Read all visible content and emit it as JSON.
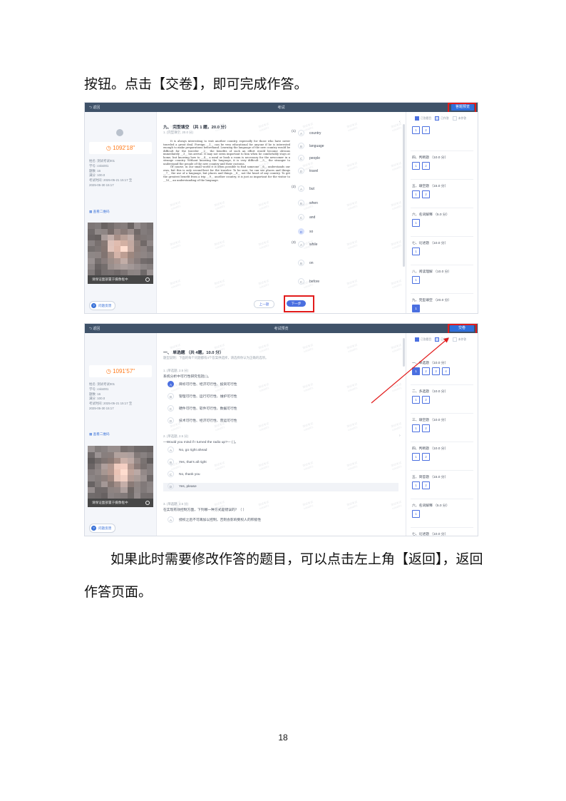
{
  "doc": {
    "top_text": "按钮。点击【交卷】，即可完成作答。",
    "bottom_line1": "如果此时需要修改作答的题目，可以点击左上角【返回】，返回",
    "bottom_line2": "作答页面。",
    "page_number": "18"
  },
  "shot1": {
    "topbar": {
      "back": "返回",
      "title": "考试",
      "button": "答题预览"
    },
    "left": {
      "timer": "1092'18\"",
      "info": "姓名: 测试考试001\n学号: csks001\n题数: 16\n满分: 100.0\n考试时间: 2025-05-21 15:17 至\n2025-05-30 15:17",
      "qr": "查看二维码",
      "cam_caption": "请保证面部置于摄像框中",
      "feedback": "问题反馈"
    },
    "section_title": "九、 完型填空 （共 1 题，20.0 分）",
    "question_meta": "1. (完型填空, 20.0 分)",
    "passage": [
      "It is always interesting to visit another country, especially for those who have never traveled a great deal. Foreign __1__ can be very educational for anyone if he is interested enough to make preparations beforehand. Learning the language of the new country would be difficult for the traveler __2__ the benefits of such an effort would become obvious immediately __3__ his arrival. It may not seem important to him when he comfortably stays at home, but knowing how to __4__ a meal or book a room is necessary for the newcomer in a strange country. Without knowing the language, it is very difficult __5__ the stranger to understand the people of the new country and their customs.",
      "Of course, in our small world it is often possible to find someone __6__ understands our own, but this is only second-best for the traveler. To be sure, he can see places and things __7__ the use of a language, but places and things __8__ not the heart of any country. To get the greatest benefit from a trip __9__ another country, it is just as important for the visitor to __10__ an understanding of the language."
    ],
    "answers": [
      {
        "num": "(1)",
        "options": [
          [
            "A",
            "country"
          ],
          [
            "B",
            "language"
          ],
          [
            "C",
            "people"
          ],
          [
            "D",
            "travel"
          ]
        ],
        "selected": ""
      },
      {
        "num": "(2)",
        "options": [
          [
            "A",
            "but"
          ],
          [
            "B",
            "when"
          ],
          [
            "C",
            "and"
          ],
          [
            "D",
            "so"
          ]
        ],
        "selected": "D"
      },
      {
        "num": "(3)",
        "options": [
          [
            "A",
            "while"
          ],
          [
            "B",
            "on"
          ],
          [
            "C",
            "before"
          ]
        ],
        "selected": ""
      }
    ],
    "nav": {
      "prev": "上一题",
      "next": "下一步"
    },
    "legend": [
      "已答题目",
      "已作答",
      "未作答"
    ],
    "right_sections": [
      {
        "title": "",
        "boxes": [
          "1",
          "2"
        ]
      },
      {
        "title": "四、判断题 （10.0 分）",
        "boxes": [
          "1",
          "2"
        ]
      },
      {
        "title": "五、填空题 （15.0 分）",
        "boxes": [
          "1",
          "2"
        ]
      },
      {
        "title": "六、名词解释 （5.0 分）",
        "boxes": [
          "1"
        ]
      },
      {
        "title": "七、论述题 （10.0 分）",
        "boxes": [
          "1"
        ]
      },
      {
        "title": "八、阅读理解 （10.0 分）",
        "boxes": [
          "1"
        ]
      },
      {
        "title": "九、完型填空 （20.0 分）",
        "boxes": [
          "1"
        ]
      }
    ]
  },
  "shot2": {
    "topbar": {
      "back": "返回",
      "title": "考试预览",
      "button": "交卷"
    },
    "left": {
      "timer": "1091'57\"",
      "info": "姓名: 测试考试001\n学号: csks001\n题数: 16\n满分: 100.0\n考试时间: 2025-05-21 15:17 至\n2025-05-30 15:17",
      "qr": "查看二维码",
      "cam_caption": "请保证面部置于摄像框中",
      "feedback": "问题反馈"
    },
    "section_title": "一、 单选题 （共 4题，10.0 分）",
    "section_note": "题型说明：下面的每个问题都有4个答案供选择，请选择你认为正确的选项。",
    "questions": [
      {
        "meta": "1. (单选题, 2.5 分)",
        "text": "系统分析中可行性研究包括(    )。",
        "options": [
          [
            "A",
            "目标可行性、经济可行性、投资可行性"
          ],
          [
            "B",
            "管理可行性、运行可行性、维护可行性"
          ],
          [
            "C",
            "硬件可行性、软件可行性、数据可行性"
          ],
          [
            "D",
            "技术可行性、经济可行性、营运可行性"
          ]
        ],
        "selected": "A"
      },
      {
        "meta": "2. (单选题, 2.5 分)",
        "text": "—Would you mind if I turned the radio up?— (  )。",
        "options": [
          [
            "A",
            "No, go right ahead"
          ],
          [
            "B",
            "Yes, that’s all right"
          ],
          [
            "C",
            "No, thank you"
          ],
          [
            "D",
            "Yes, please"
          ]
        ],
        "selected": ""
      },
      {
        "meta": "3. (单选题, 2.5 分)",
        "text": "在实现有效控制方面，下列哪一种方式是错误的？（    ）",
        "options": [
          [
            "A",
            "授权之后不可再加以控制，否则会影响受权人的积极性"
          ]
        ],
        "selected": ""
      }
    ],
    "legend": [
      "已答题目",
      "已作答",
      "未作答"
    ],
    "right_sections": [
      {
        "title": "一、单选题 （10.0 分）",
        "boxes": [
          "1",
          "2",
          "3",
          "4"
        ]
      },
      {
        "title": "二、多选题 （10.0 分）",
        "boxes": [
          "1",
          "2"
        ]
      },
      {
        "title": "三、填空题 （10.0 分）",
        "boxes": [
          "1",
          "2"
        ]
      },
      {
        "title": "四、判断题 （10.0 分）",
        "boxes": [
          "1",
          "2"
        ]
      },
      {
        "title": "五、简答题 （15.0 分）",
        "boxes": [
          "1",
          "2"
        ]
      },
      {
        "title": "六、名词解释 （5.0 分）",
        "boxes": [
          "1"
        ]
      },
      {
        "title": "七、论述题 （10.0 分）",
        "boxes": []
      }
    ]
  },
  "colors": {
    "topbar": "#3f5269",
    "primary": "#4a6fe0",
    "highlight": "#e21b1b",
    "timer": "#ff7a1a"
  },
  "watermark": "测试考试\ncsks001"
}
